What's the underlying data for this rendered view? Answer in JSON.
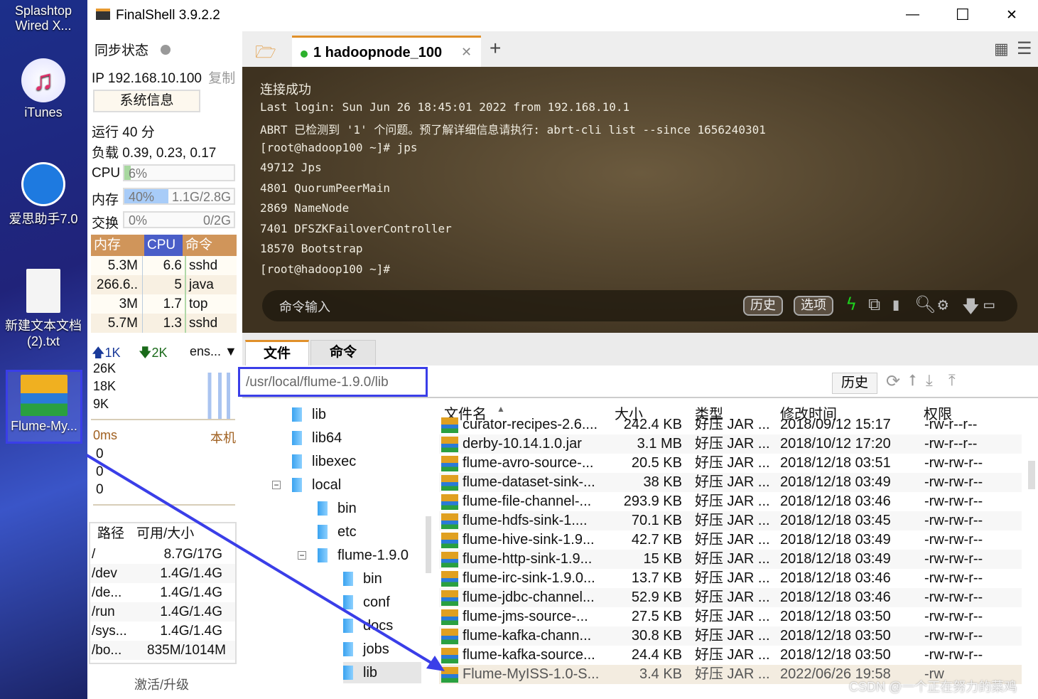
{
  "desktop": {
    "items": [
      {
        "label": "Splashtop Wired X..."
      },
      {
        "label": "iTunes"
      },
      {
        "label": "爱思助手7.0"
      },
      {
        "label": "新建文本文档 (2).txt"
      },
      {
        "label": "Flume-My..."
      }
    ]
  },
  "window": {
    "title": "FinalShell 3.9.2.2",
    "minimize": "—",
    "maximize": "☐",
    "close": "✕"
  },
  "left": {
    "sync_label": "同步状态",
    "ip": "IP 192.168.10.100",
    "copy": "复制",
    "sysinfo": "系统信息",
    "uptime": "运行 40 分",
    "load": "负载 0.39, 0.23, 0.17",
    "cpu": {
      "label": "CPU",
      "percent": "6%",
      "fill": 6
    },
    "mem": {
      "label": "内存",
      "percent": "40%",
      "detail": "1.1G/2.8G",
      "fill": 40
    },
    "swap": {
      "label": "交换",
      "percent": "0%",
      "detail": "0/2G",
      "fill": 0
    },
    "proc_headers": [
      "内存",
      "CPU",
      "命令"
    ],
    "procs": [
      [
        "5.3M",
        "6.6",
        "sshd"
      ],
      [
        "266.6..",
        "5",
        "java"
      ],
      [
        "3M",
        "1.7",
        "top"
      ],
      [
        "5.7M",
        "1.3",
        "sshd"
      ]
    ],
    "net": {
      "up": "1K",
      "down": "2K",
      "iface": "ens...",
      "ticks": [
        "26K",
        "18K",
        "9K"
      ]
    },
    "ping": {
      "latency": "0ms",
      "host": "本机",
      "ticks": [
        "0",
        "0",
        "0"
      ]
    },
    "disk_headers": [
      "路径",
      "可用/大小"
    ],
    "disks": [
      [
        "/",
        "8.7G/17G"
      ],
      [
        "/dev",
        "1.4G/1.4G"
      ],
      [
        "/de...",
        "1.4G/1.4G"
      ],
      [
        "/run",
        "1.4G/1.4G"
      ],
      [
        "/sys...",
        "1.4G/1.4G"
      ],
      [
        "/bo...",
        "835M/1014M"
      ]
    ],
    "activate": "激活/升级"
  },
  "tabs": {
    "active": "1 hadoopnode_100",
    "add": "+"
  },
  "terminal": {
    "lines": [
      "连接成功",
      "Last login: Sun Jun 26 18:45:01 2022 from 192.168.10.1",
      "ABRT 已检测到 '1' 个问题。预了解详细信息请执行: abrt-cli list --since 1656240301",
      "[root@hadoop100 ~]# jps",
      "49712 Jps",
      "4801 QuorumPeerMain",
      "2869 NameNode",
      "7401 DFSZKFailoverController",
      "18570 Bootstrap",
      "[root@hadoop100 ~]#"
    ],
    "cmd_placeholder": "命令输入",
    "history": "历史",
    "options": "选项"
  },
  "files": {
    "tab_files": "文件",
    "tab_cmd": "命令",
    "path": "/usr/local/flume-1.9.0/lib",
    "history": "历史",
    "tree": [
      "lib",
      "lib64",
      "libexec",
      "local",
      "bin",
      "etc",
      "flume-1.9.0",
      "bin",
      "conf",
      "docs",
      "jobs",
      "lib"
    ],
    "headers": [
      "文件名",
      "大小",
      "类型",
      "修改时间",
      "权限"
    ],
    "rows": [
      [
        "curator-recipes-2.6....",
        "242.4 KB",
        "好压 JAR ...",
        "2018/09/12 15:17",
        "-rw-r--r--"
      ],
      [
        "derby-10.14.1.0.jar",
        "3.1 MB",
        "好压 JAR ...",
        "2018/10/12 17:20",
        "-rw-r--r--"
      ],
      [
        "flume-avro-source-...",
        "20.5 KB",
        "好压 JAR ...",
        "2018/12/18 03:51",
        "-rw-rw-r--"
      ],
      [
        "flume-dataset-sink-...",
        "38 KB",
        "好压 JAR ...",
        "2018/12/18 03:49",
        "-rw-rw-r--"
      ],
      [
        "flume-file-channel-...",
        "293.9 KB",
        "好压 JAR ...",
        "2018/12/18 03:46",
        "-rw-rw-r--"
      ],
      [
        "flume-hdfs-sink-1....",
        "70.1 KB",
        "好压 JAR ...",
        "2018/12/18 03:45",
        "-rw-rw-r--"
      ],
      [
        "flume-hive-sink-1.9...",
        "42.7 KB",
        "好压 JAR ...",
        "2018/12/18 03:49",
        "-rw-rw-r--"
      ],
      [
        "flume-http-sink-1.9...",
        "15 KB",
        "好压 JAR ...",
        "2018/12/18 03:49",
        "-rw-rw-r--"
      ],
      [
        "flume-irc-sink-1.9.0...",
        "13.7 KB",
        "好压 JAR ...",
        "2018/12/18 03:46",
        "-rw-rw-r--"
      ],
      [
        "flume-jdbc-channel...",
        "52.9 KB",
        "好压 JAR ...",
        "2018/12/18 03:46",
        "-rw-rw-r--"
      ],
      [
        "flume-jms-source-...",
        "27.5 KB",
        "好压 JAR ...",
        "2018/12/18 03:50",
        "-rw-rw-r--"
      ],
      [
        "flume-kafka-chann...",
        "30.8 KB",
        "好压 JAR ...",
        "2018/12/18 03:50",
        "-rw-rw-r--"
      ],
      [
        "flume-kafka-source...",
        "24.4 KB",
        "好压 JAR ...",
        "2018/12/18 03:50",
        "-rw-rw-r--"
      ],
      [
        "Flume-MyISS-1.0-S...",
        "3.4 KB",
        "好压 JAR ...",
        "2022/06/26 19:58",
        "-rw"
      ]
    ]
  },
  "watermark": "CSDN @一个正在努力的菜鸡",
  "annotation_color": "#3a3ee8"
}
